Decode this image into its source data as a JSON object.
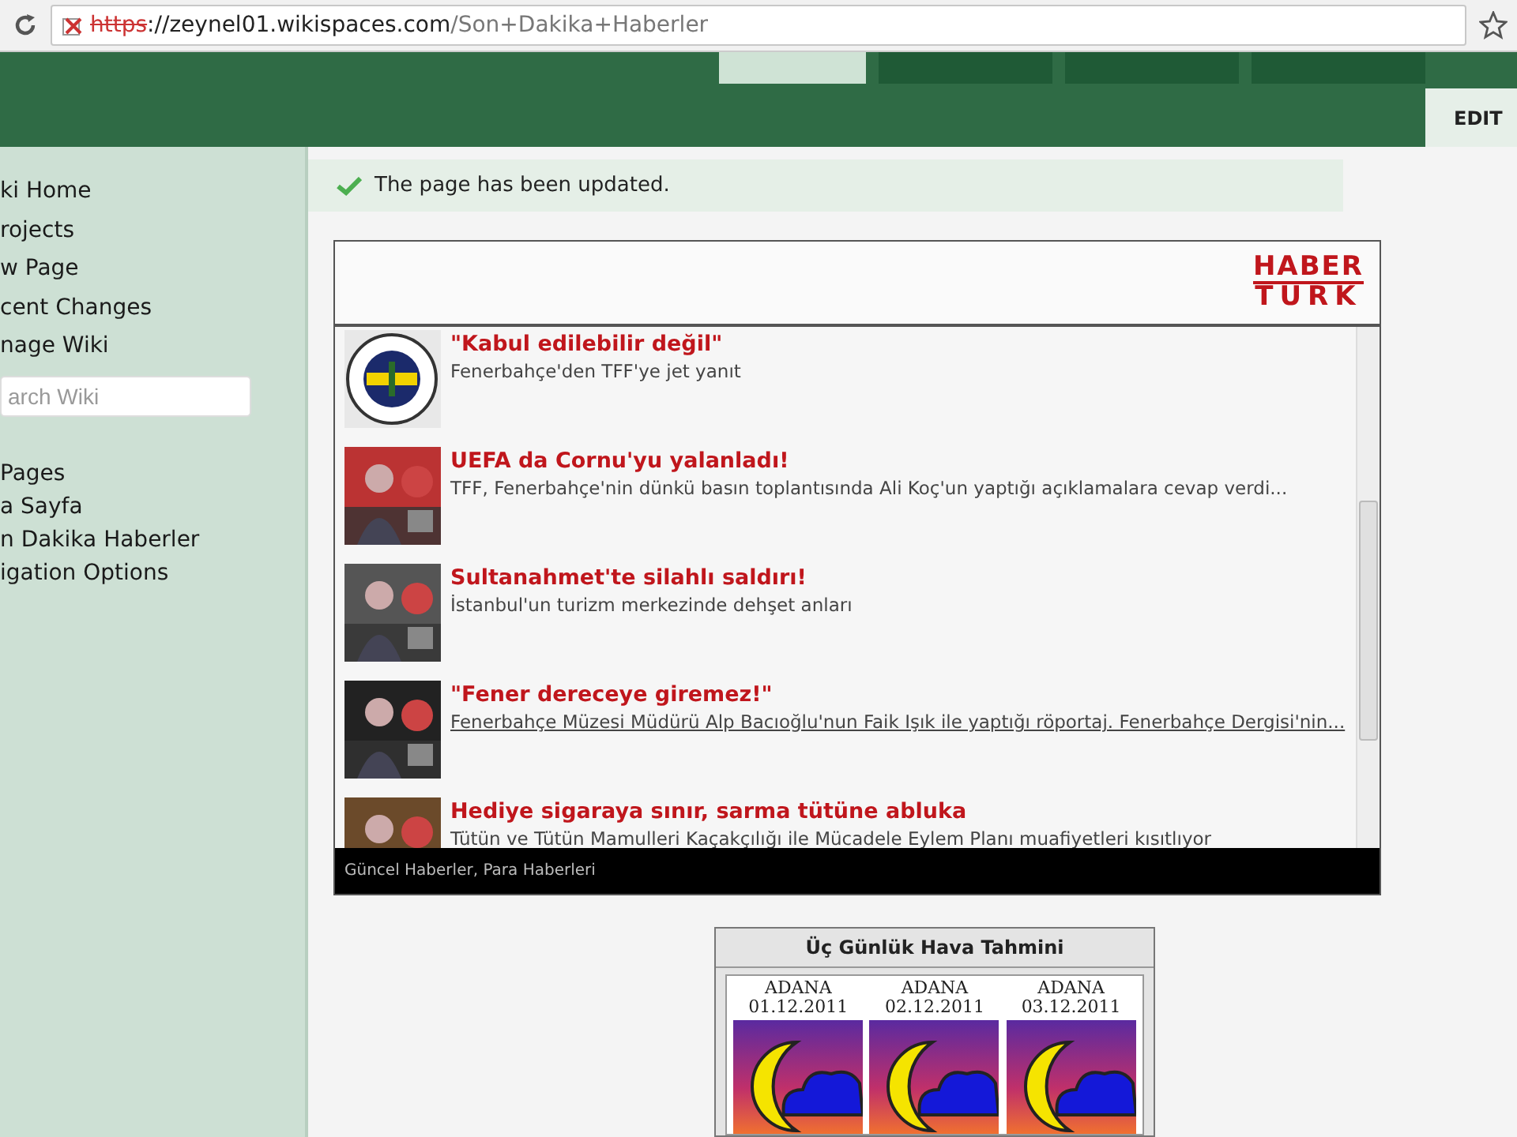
{
  "browser": {
    "url_scheme": "https",
    "url_host": "://zeynel01.wikispaces.com",
    "url_path": "/Son+Dakika+Haberler"
  },
  "header": {
    "tabs": [
      {
        "selected": true
      },
      {
        "selected": false
      },
      {
        "selected": false
      },
      {
        "selected": false
      }
    ],
    "edit_button": "EDIT"
  },
  "sidebar": {
    "items": [
      "ki Home",
      "rojects",
      "w Page",
      "cent Changes",
      "nage Wiki"
    ],
    "search": {
      "placeholder": "arch Wiki"
    },
    "pages": [
      "Pages",
      "a Sayfa",
      "n Dakika Haberler",
      "igation Options"
    ]
  },
  "notice": "The page has been updated.",
  "news_widget": {
    "logo_top": "HABER",
    "logo_bottom": "TURK",
    "items": [
      {
        "title": "\"Kabul edilebilir değil\"",
        "summary": "Fenerbahçe'den TFF'ye jet yanıt",
        "underlined": false
      },
      {
        "title": "UEFA da Cornu'yu yalanladı!",
        "summary": "TFF, Fenerbahçe'nin dünkü basın toplantısında Ali Koç'un yaptığı açıklamalara cevap verdi...",
        "underlined": false
      },
      {
        "title": "Sultanahmet'te silahlı saldırı!",
        "summary": "İstanbul'un turizm merkezinde dehşet anları",
        "underlined": false
      },
      {
        "title": "\"Fener dereceye giremez!\"",
        "summary": "Fenerbahçe Müzesi Müdürü Alp Bacıoğlu'nun Faik Işık ile yaptığı röportaj. Fenerbahçe Dergisi'nin...",
        "underlined": true
      },
      {
        "title": "Hediye sigaraya sınır, sarma tütüne abluka",
        "summary": "Tütün ve Tütün Mamulleri Kaçakçılığı ile Mücadele Eylem Planı muafiyetleri kısıtlıyor",
        "underlined": false
      }
    ],
    "footer": "Güncel Haberler, Para Haberleri"
  },
  "weather": {
    "title": "Üç Günlük Hava Tahmini",
    "days": [
      {
        "city": "ADANA",
        "date": "01.12.2011"
      },
      {
        "city": "ADANA",
        "date": "02.12.2011"
      },
      {
        "city": "ADANA",
        "date": "03.12.2011"
      }
    ]
  }
}
